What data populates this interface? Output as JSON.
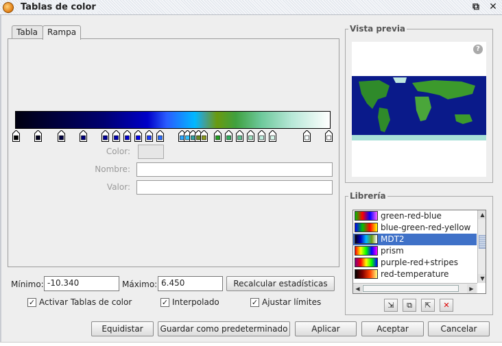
{
  "window": {
    "title": "Tablas de color",
    "icon": "app-globe-icon"
  },
  "tabs": [
    {
      "label": "Tabla",
      "active": false
    },
    {
      "label": "Rampa",
      "active": true
    }
  ],
  "ramp_editor": {
    "stop_colors": [
      "#000000",
      "#000020",
      "#000040",
      "#00007a",
      "#00009a",
      "#0000b4",
      "#0000d2",
      "#0000ee",
      "#1a3aff",
      "#2a6cff",
      "#2fa8ff",
      "#2fc4ff",
      "#36a0a0",
      "#6a8a20",
      "#8a9a20",
      "#20a020",
      "#30b060",
      "#60c090",
      "#a0e0c0",
      "#c0f0e0",
      "#d8f8ec",
      "#f8ffff",
      "#ffffff"
    ],
    "color_label": "Color:",
    "nombre_label": "Nombre:",
    "valor_label": "Valor:",
    "nombre_value": "",
    "valor_value": ""
  },
  "stats": {
    "min_label": "Mínimo:",
    "min_value": "-10.340",
    "max_label": "Máximo:",
    "max_value": "6.450",
    "recalc_label": "Recalcular estadísticas"
  },
  "options": {
    "activar": {
      "label": "Activar Tablas de color",
      "checked": true
    },
    "interpolado": {
      "label": "Interpolado",
      "checked": true
    },
    "ajustar": {
      "label": "Ajustar límites",
      "checked": true
    }
  },
  "preview": {
    "title": "Vista previa",
    "help_icon": "help-icon"
  },
  "library": {
    "title": "Librería",
    "items": [
      {
        "name": "green-red-blue",
        "gradient": "linear-gradient(to right,#00c000,#ff0000,#0000ff,#ff60ff)",
        "selected": false
      },
      {
        "name": "blue-green-red-yellow",
        "gradient": "linear-gradient(to right,#0000ff,#00c000,#ff0000,#ffff00)",
        "selected": false
      },
      {
        "name": "MDT2",
        "gradient": "linear-gradient(to right,#000010,#0000c8,#00b8ff,#6a9a10,#ffffff)",
        "selected": true
      },
      {
        "name": "prism",
        "gradient": "linear-gradient(to right,#ff0000,#ffff00,#00ff00,#0000ff,#ff00ff)",
        "selected": false
      },
      {
        "name": "purple-red+stripes",
        "gradient": "linear-gradient(to right,#800080,#ff0000,#ffff00,#00ff00,#0000ff)",
        "selected": false
      },
      {
        "name": "red-temperature",
        "gradient": "linear-gradient(to right,#000000,#800000,#ff4000,#ffff80)",
        "selected": false
      }
    ],
    "buttons": [
      "import-table-icon",
      "copy-table-icon",
      "export-table-icon",
      "delete-table-icon"
    ]
  },
  "footer": {
    "equidistar": "Equidistar",
    "guardar": "Guardar como predeterminado",
    "aplicar": "Aplicar",
    "aceptar": "Aceptar",
    "cancelar": "Cancelar"
  }
}
